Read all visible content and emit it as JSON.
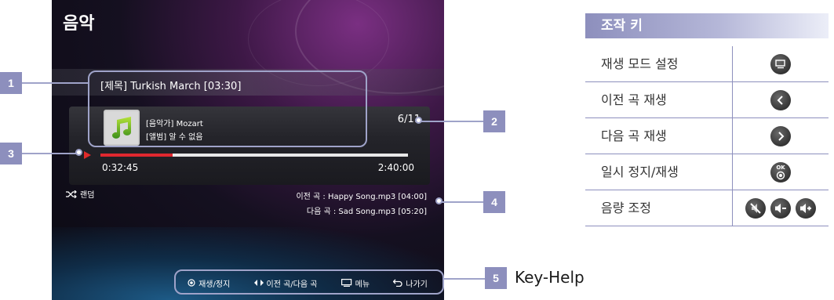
{
  "screen": {
    "title": "음악",
    "song_title": "[제목] Turkish March [03:30]",
    "artist": "[음악가] Mozart",
    "album": "[앨범] 알 수 없음",
    "track_count": "6/11",
    "progress": 0.235,
    "time_elapsed": "0:32:45",
    "time_total": "2:40:00",
    "shuffle_label": "랜덤",
    "prev_song": "이전 곡 : Happy Song.mp3 [04:00]",
    "next_song": "다음 곡 : Sad Song.mp3 [05:20]",
    "keyhelp": {
      "play_stop": "재생/정지",
      "prev_next": "이전 곡/다음 곡",
      "menu": "메뉴",
      "exit": "나가기"
    }
  },
  "callouts": {
    "c1": "1",
    "c2": "2",
    "c3": "3",
    "c4": "4",
    "c5": "5",
    "keyhelp_label": "Key-Help"
  },
  "control_keys": {
    "header": "조작 키",
    "rows": [
      {
        "label": "재생 모드 설정",
        "icons": [
          "tools-icon"
        ]
      },
      {
        "label": "이전 곡 재생",
        "icons": [
          "left-arrow-icon"
        ]
      },
      {
        "label": "다음 곡 재생",
        "icons": [
          "right-arrow-icon"
        ]
      },
      {
        "label": "일시 정지/재생",
        "icons": [
          "ok-icon"
        ],
        "ok_text": "OK"
      },
      {
        "label": "음량 조정",
        "icons": [
          "mute-icon",
          "volume-down-icon",
          "volume-up-icon"
        ]
      }
    ]
  },
  "colors": {
    "accent": "#8d8fbd",
    "progress_fill": "#e0282f",
    "frame": "#9fa3c9"
  }
}
